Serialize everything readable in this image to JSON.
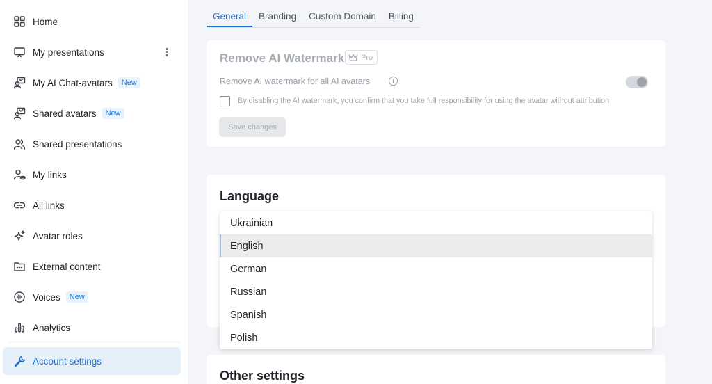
{
  "sidebar": {
    "items": [
      {
        "label": "Home",
        "icon": "grid-icon"
      },
      {
        "label": "My presentations",
        "icon": "presentation-icon"
      },
      {
        "label": "My AI Chat-avatars",
        "icon": "avatar-icon",
        "badge": "New"
      },
      {
        "label": "Shared avatars",
        "icon": "avatar-icon",
        "badge": "New"
      },
      {
        "label": "Shared presentations",
        "icon": "users-icon"
      },
      {
        "label": "My links",
        "icon": "user-link-icon"
      },
      {
        "label": "All links",
        "icon": "link-icon"
      },
      {
        "label": "Avatar roles",
        "icon": "sparkle-icon"
      },
      {
        "label": "External content",
        "icon": "folder-icon"
      },
      {
        "label": "Voices",
        "icon": "voice-icon",
        "badge": "New"
      },
      {
        "label": "Analytics",
        "icon": "bar-chart-icon"
      },
      {
        "label": "Account settings",
        "icon": "wrench-icon"
      }
    ]
  },
  "tabs": [
    "General",
    "Branding",
    "Custom Domain",
    "Billing"
  ],
  "watermark": {
    "title": "Remove AI Watermark",
    "pro_badge": "Pro",
    "toggle_label": "Remove AI watermark for all AI avatars",
    "checkbox_text": "By disabling the AI watermark, you confirm that you take full responsibility for using the avatar without attribution",
    "save_label": "Save changes"
  },
  "language": {
    "title": "Language",
    "options": [
      "Ukrainian",
      "English",
      "German",
      "Russian",
      "Spanish",
      "Polish"
    ],
    "selected": "English"
  },
  "other": {
    "title": "Other settings"
  },
  "colors": {
    "accent": "#1f6fd1",
    "badge_bg": "#e8f2fd",
    "active_bg": "#e6f0fb"
  }
}
